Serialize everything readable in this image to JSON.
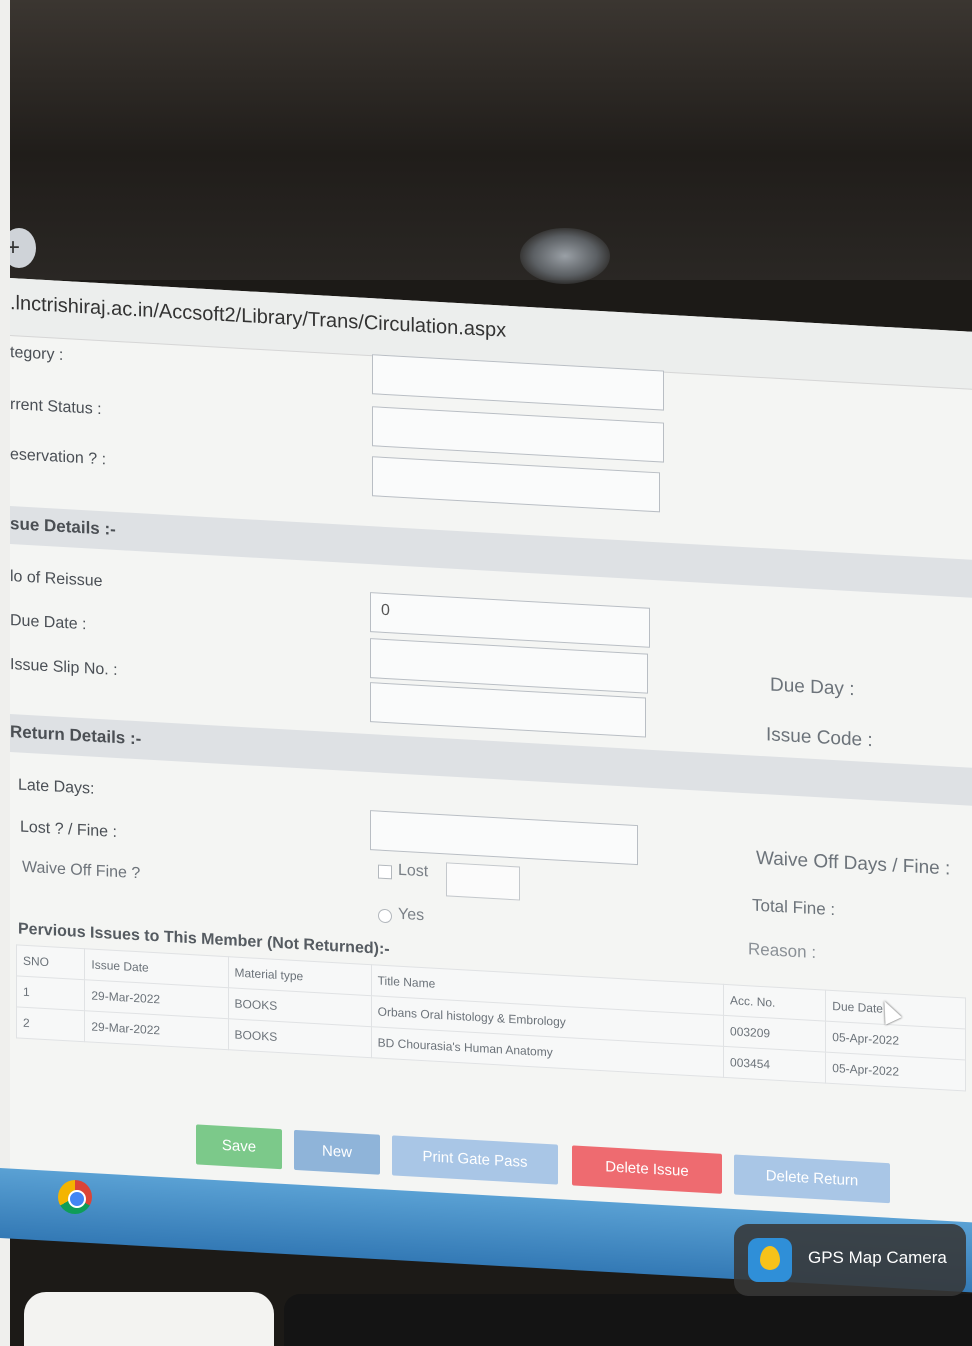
{
  "browser": {
    "url": ".lnctrishiraj.ac.in/Accsoft2/Library/Trans/Circulation.aspx"
  },
  "form_top": {
    "category_label": "tegory :",
    "current_status_label": "rrent Status :",
    "reservation_label": "eservation ? :"
  },
  "issue_details": {
    "heading": "sue Details :-",
    "no_of_reissue_label": "lo of Reissue",
    "no_of_reissue_value": "0",
    "due_date_label": "Due Date :",
    "issue_slip_label": "Issue Slip No. :",
    "due_day_label": "Due Day :",
    "issue_code_label": "Issue Code :"
  },
  "return_details": {
    "heading": "Return Details :-",
    "late_days_label": "Late Days:",
    "lost_fine_label": "Lost ? / Fine :",
    "waive_off_fine_label": "Waive Off Fine ?",
    "lost_checkbox_label": "Lost",
    "yes_checkbox_label": "Yes",
    "waive_off_days_label": "Waive Off Days / Fine :",
    "total_fine_label": "Total Fine :",
    "reason_label": "Reason :"
  },
  "previous_issues": {
    "heading": "Pervious Issues to This Member (Not Returned):-",
    "columns": [
      "SNO",
      "Issue Date",
      "Material type",
      "Title Name",
      "Acc. No.",
      "Due Date"
    ],
    "rows": [
      [
        "1",
        "29-Mar-2022",
        "BOOKS",
        "Orbans Oral histology & Embrology",
        "003209",
        "05-Apr-2022"
      ],
      [
        "2",
        "29-Mar-2022",
        "BOOKS",
        "BD Chourasia's Human Anatomy",
        "003454",
        "05-Apr-2022"
      ]
    ]
  },
  "actions": {
    "save": "Save",
    "new": "New",
    "print_gate_pass": "Print Gate Pass",
    "delete_issue": "Delete Issue",
    "delete_return": "Delete Return"
  },
  "overlay": {
    "gps_label": "GPS Map Camera"
  },
  "colors": {
    "save": "#7cc98a",
    "new": "#8fb4d9",
    "print": "#a9c6e6",
    "delete_issue": "#ee6b70",
    "delete_return": "#a9c6e6"
  }
}
